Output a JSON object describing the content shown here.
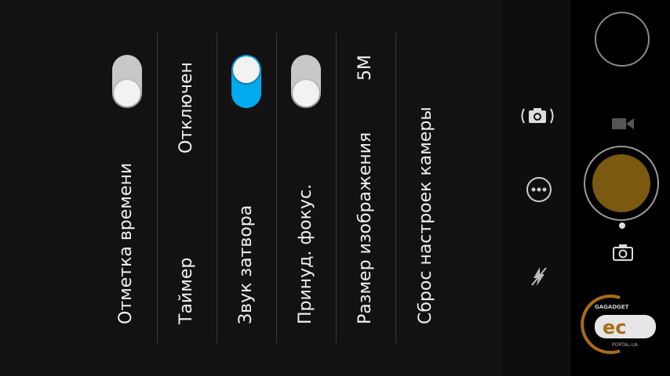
{
  "settings": [
    {
      "label": "Отметка времени",
      "control": "toggle",
      "state": "off"
    },
    {
      "label": "Таймер",
      "value": "Отключен"
    },
    {
      "label": "Звук затвора",
      "control": "toggle",
      "state": "on"
    },
    {
      "label": "Принуд. фокус.",
      "control": "toggle",
      "state": "off"
    },
    {
      "label": "Размер изображения",
      "value": "5M"
    },
    {
      "label": "Сброс настроек камеры"
    }
  ],
  "side_icons": [
    "camera-switch-icon",
    "more-options-icon",
    "flash-off-icon"
  ],
  "controls_icons": [
    "thumbnail-preview",
    "video-mode-icon",
    "shutter-button",
    "photo-mode-icon"
  ],
  "watermark": {
    "text": "GAGADGET",
    "sub": "PORTAL.UA"
  },
  "colors": {
    "accent": "#00aaee",
    "shutter": "#7a5a10",
    "toggle_off": "#c8c8c8"
  }
}
